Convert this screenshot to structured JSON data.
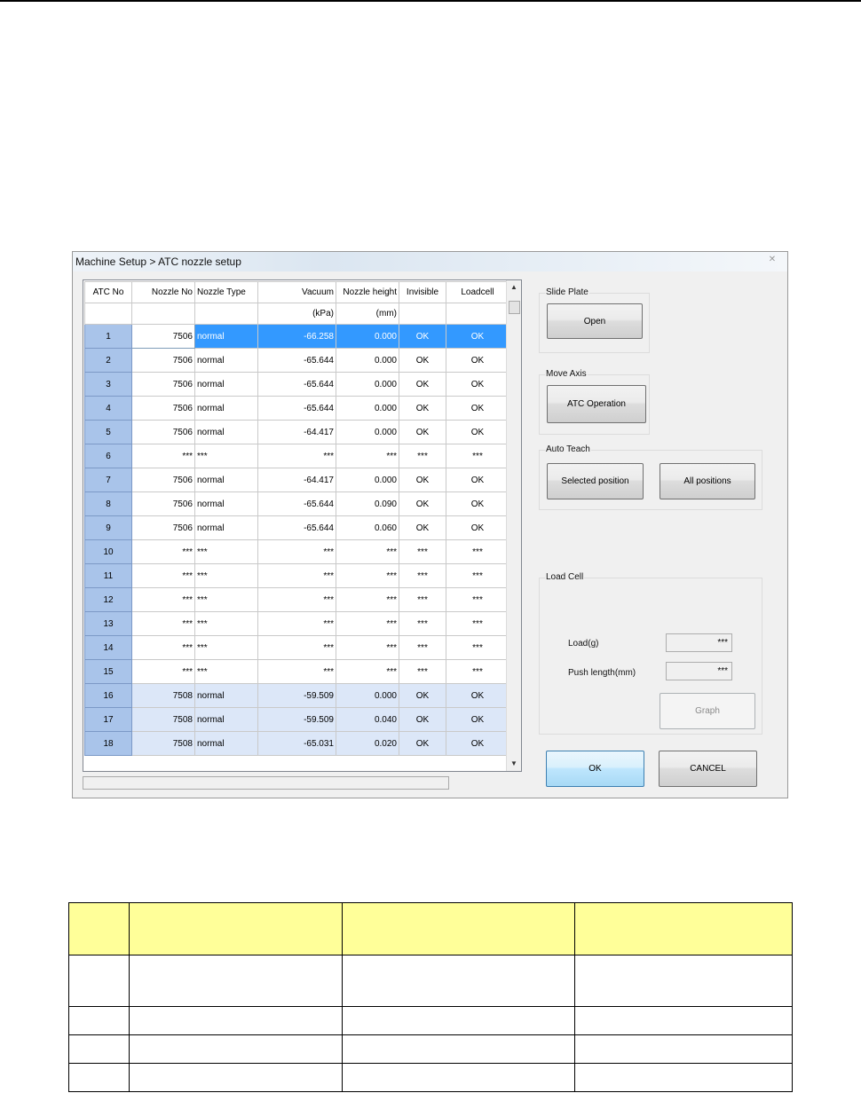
{
  "window": {
    "title": "Machine Setup > ATC nozzle setup"
  },
  "grid": {
    "headers": [
      "ATC No",
      "Nozzle No",
      "Nozzle Type",
      "Vacuum",
      "Nozzle height",
      "Invisible",
      "Loadcell"
    ],
    "units": [
      "",
      "",
      "",
      "(kPa)",
      "(mm)",
      "",
      ""
    ],
    "rows": [
      [
        "1",
        "7506",
        "normal",
        "-66.258",
        "0.000",
        "OK",
        "OK"
      ],
      [
        "2",
        "7506",
        "normal",
        "-65.644",
        "0.000",
        "OK",
        "OK"
      ],
      [
        "3",
        "7506",
        "normal",
        "-65.644",
        "0.000",
        "OK",
        "OK"
      ],
      [
        "4",
        "7506",
        "normal",
        "-65.644",
        "0.000",
        "OK",
        "OK"
      ],
      [
        "5",
        "7506",
        "normal",
        "-64.417",
        "0.000",
        "OK",
        "OK"
      ],
      [
        "6",
        "***",
        "***",
        "***",
        "***",
        "***",
        "***"
      ],
      [
        "7",
        "7506",
        "normal",
        "-64.417",
        "0.000",
        "OK",
        "OK"
      ],
      [
        "8",
        "7506",
        "normal",
        "-65.644",
        "0.090",
        "OK",
        "OK"
      ],
      [
        "9",
        "7506",
        "normal",
        "-65.644",
        "0.060",
        "OK",
        "OK"
      ],
      [
        "10",
        "***",
        "***",
        "***",
        "***",
        "***",
        "***"
      ],
      [
        "11",
        "***",
        "***",
        "***",
        "***",
        "***",
        "***"
      ],
      [
        "12",
        "***",
        "***",
        "***",
        "***",
        "***",
        "***"
      ],
      [
        "13",
        "***",
        "***",
        "***",
        "***",
        "***",
        "***"
      ],
      [
        "14",
        "***",
        "***",
        "***",
        "***",
        "***",
        "***"
      ],
      [
        "15",
        "***",
        "***",
        "***",
        "***",
        "***",
        "***"
      ],
      [
        "16",
        "7508",
        "normal",
        "-59.509",
        "0.000",
        "OK",
        "OK"
      ],
      [
        "17",
        "7508",
        "normal",
        "-59.509",
        "0.040",
        "OK",
        "OK"
      ],
      [
        "18",
        "7508",
        "normal",
        "-65.031",
        "0.020",
        "OK",
        "OK"
      ]
    ],
    "selected_row": 0,
    "highlighted_rows": [
      15,
      16,
      17
    ]
  },
  "slide_plate": {
    "label": "Slide Plate",
    "open_button": "Open"
  },
  "move_axis": {
    "label": "Move Axis",
    "atc_operation_button": "ATC Operation"
  },
  "auto_teach": {
    "label": "Auto Teach",
    "selected_position_button": "Selected position",
    "all_positions_button": "All positions"
  },
  "load_cell": {
    "label": "Load Cell",
    "load_label": "Load(g)",
    "load_value": "***",
    "push_length_label": "Push length(mm)",
    "push_length_value": "***",
    "graph_button": "Graph"
  },
  "footer": {
    "ok_button": "OK",
    "cancel_button": "CANCEL"
  },
  "colors": {
    "selection": "#3399ff",
    "atc_cell": "#a9c4ea",
    "alt_row": "#dce7f8",
    "legend_header": "#ffff99"
  }
}
